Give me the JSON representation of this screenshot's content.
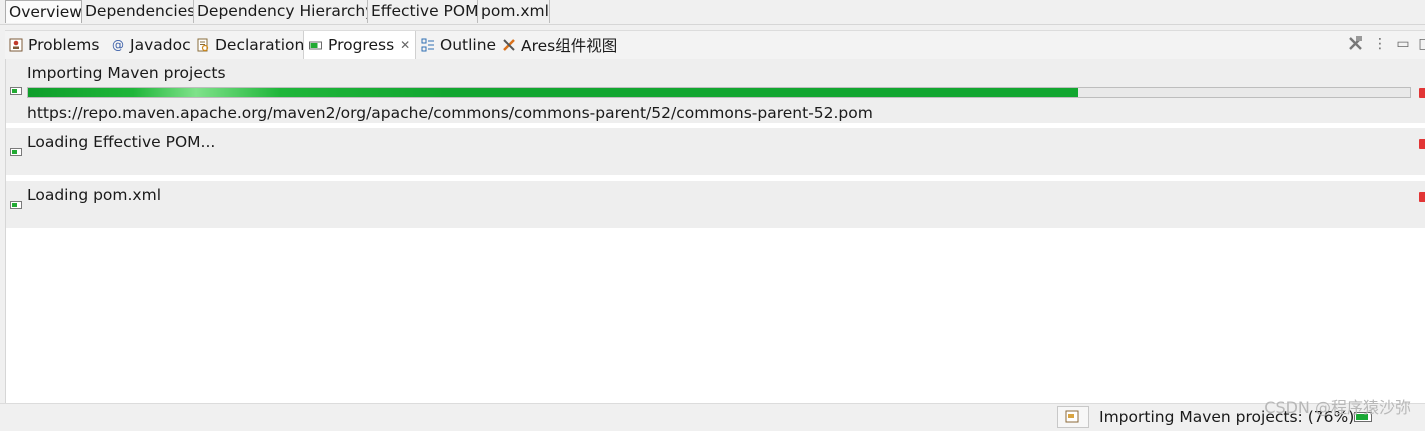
{
  "editor_tabs": [
    "Overview",
    "Dependencies",
    "Dependency Hierarchy",
    "Effective POM",
    "pom.xml"
  ],
  "view_tabs": [
    {
      "label": "Problems",
      "icon": "problems-icon"
    },
    {
      "label": "Javadoc",
      "icon": "javadoc-icon"
    },
    {
      "label": "Declaration",
      "icon": "declaration-icon"
    },
    {
      "label": "Progress",
      "icon": "progress-icon",
      "active": true
    },
    {
      "label": "Outline",
      "icon": "outline-icon"
    },
    {
      "label": "Ares组件视图",
      "icon": "ares-icon"
    }
  ],
  "toolbar": {
    "remove_all_icon": "remove-all-finished-icon",
    "view_menu_icon": "view-menu-icon",
    "minimize_icon": "minimize-icon",
    "maximize_icon": "maximize-icon"
  },
  "jobs": [
    {
      "title": "Importing Maven projects",
      "progress": 0.76,
      "detail": "https://repo.maven.apache.org/maven2/org/apache/commons/commons-parent/52/commons-parent-52.pom"
    },
    {
      "title": "Loading Effective POM..."
    },
    {
      "title": "Loading pom.xml"
    }
  ],
  "status": {
    "text": "Importing Maven projects: (76%)",
    "progress_percent": 76
  },
  "watermark": "CSDN @程序猿沙弥",
  "colors": {
    "progress_fill": "#12a630",
    "stop": "#e23535",
    "background": "#f0f0f0"
  }
}
